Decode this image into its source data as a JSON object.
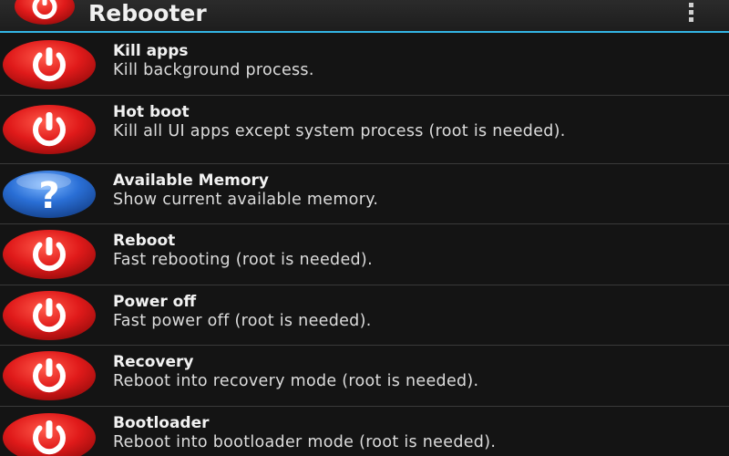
{
  "app": {
    "title": "Rebooter"
  },
  "colors": {
    "accent": "#33b5e5",
    "power_red": "#e01a1a",
    "help_blue": "#2a6fd6"
  },
  "actionbar": {
    "app_icon": "power-icon",
    "overflow_icon": "overflow-menu-icon"
  },
  "items": [
    {
      "title": "Kill apps",
      "subtitle": "Kill background process.",
      "icon": "power-icon"
    },
    {
      "title": "Hot boot",
      "subtitle": "Kill all UI apps except system process (root is needed).",
      "icon": "power-icon"
    },
    {
      "title": "Available Memory",
      "subtitle": "Show current available memory.",
      "icon": "help-icon"
    },
    {
      "title": "Reboot",
      "subtitle": "Fast rebooting (root is needed).",
      "icon": "power-icon"
    },
    {
      "title": "Power off",
      "subtitle": "Fast power off (root is needed).",
      "icon": "power-icon"
    },
    {
      "title": "Recovery",
      "subtitle": "Reboot into recovery mode (root is needed).",
      "icon": "power-icon"
    },
    {
      "title": "Bootloader",
      "subtitle": "Reboot into bootloader mode (root is needed).",
      "icon": "power-icon"
    }
  ]
}
